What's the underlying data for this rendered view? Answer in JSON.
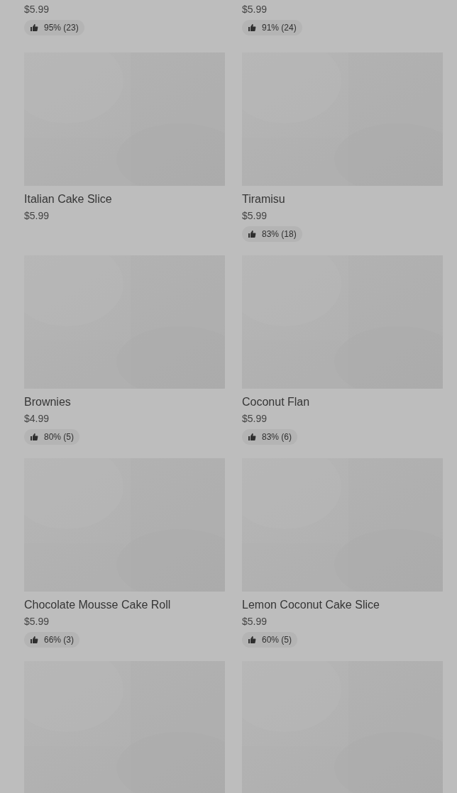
{
  "items": [
    {
      "price": "$5.99",
      "rating": "95% (23)"
    },
    {
      "price": "$5.99",
      "rating": "91% (24)"
    },
    {
      "kind": "picture",
      "name": "Italian Cake Slice",
      "price": "$5.99"
    },
    {
      "kind": "picture",
      "name": "Tiramisu",
      "price": "$5.99",
      "rating": "83% (18)"
    },
    {
      "kind": "picture",
      "name": "Brownies",
      "price": "$4.99",
      "rating": "80% (5)"
    },
    {
      "kind": "picture",
      "name": "Coconut Flan",
      "price": "$5.99",
      "rating": "83% (6)"
    },
    {
      "kind": "picture",
      "name": "Chocolate Mousse Cake Roll",
      "price": "$5.99",
      "rating": "66% (3)"
    },
    {
      "kind": "picture",
      "name": "Lemon Coconut Cake Slice",
      "price": "$5.99",
      "rating": "60% (5)"
    },
    {
      "kind": "picture"
    },
    {
      "kind": "picture"
    }
  ]
}
